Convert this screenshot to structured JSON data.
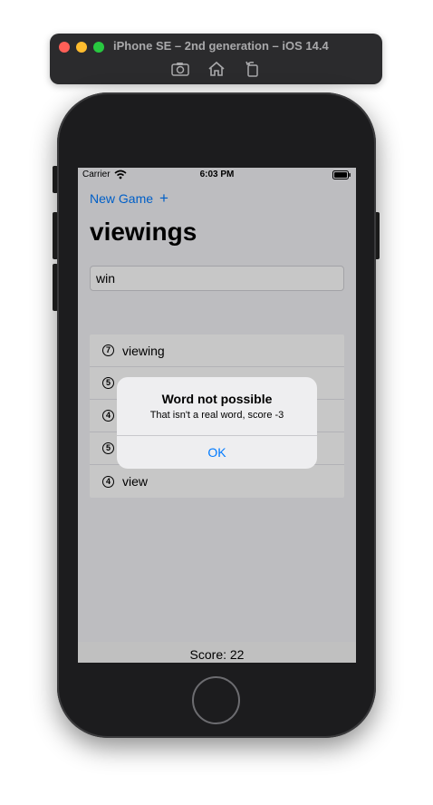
{
  "simulator": {
    "title": "iPhone SE – 2nd generation – iOS 14.4",
    "tools": [
      "screenshot-icon",
      "home-icon",
      "rotate-icon"
    ]
  },
  "status_bar": {
    "carrier": "Carrier",
    "time": "6:03 PM"
  },
  "nav": {
    "new_game_label": "New Game",
    "plus_label": "+"
  },
  "root_word": "viewings",
  "input": {
    "value": "win"
  },
  "used_words": [
    {
      "count": "7",
      "word": "viewing"
    },
    {
      "count": "5",
      "word": ""
    },
    {
      "count": "4",
      "word": ""
    },
    {
      "count": "5",
      "word": ""
    },
    {
      "count": "4",
      "word": "view"
    }
  ],
  "score_text": "Score: 22",
  "alert": {
    "title": "Word not possible",
    "message": "That isn't a real word, score -3",
    "button_label": "OK"
  },
  "colors": {
    "accent": "#007aff",
    "background": "#f2f2f7"
  }
}
